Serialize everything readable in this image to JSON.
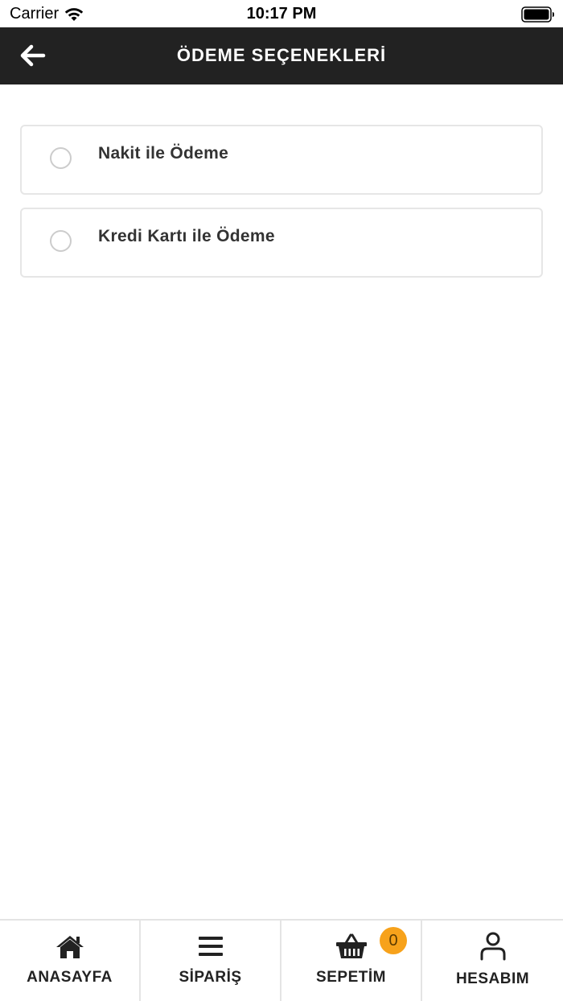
{
  "status_bar": {
    "carrier": "Carrier",
    "time": "10:17 PM",
    "wifi_icon": "wifi-icon",
    "battery_icon": "battery-icon"
  },
  "header": {
    "title": "ÖDEME SEÇENEKLERİ",
    "back_icon": "arrow-left-icon",
    "background_color": "#222222"
  },
  "payment_options": [
    {
      "label": "Nakit ile Ödeme",
      "selected": false
    },
    {
      "label": "Kredi Kartı ile Ödeme",
      "selected": false
    }
  ],
  "bottom_nav": {
    "items": [
      {
        "label": "ANASAYFA",
        "icon": "home-icon"
      },
      {
        "label": "SİPARİŞ",
        "icon": "list-icon"
      },
      {
        "label": "SEPETİM",
        "icon": "basket-icon",
        "badge": "0"
      },
      {
        "label": "HESABIM",
        "icon": "user-icon"
      }
    ],
    "badge_color": "#f7a21b"
  }
}
